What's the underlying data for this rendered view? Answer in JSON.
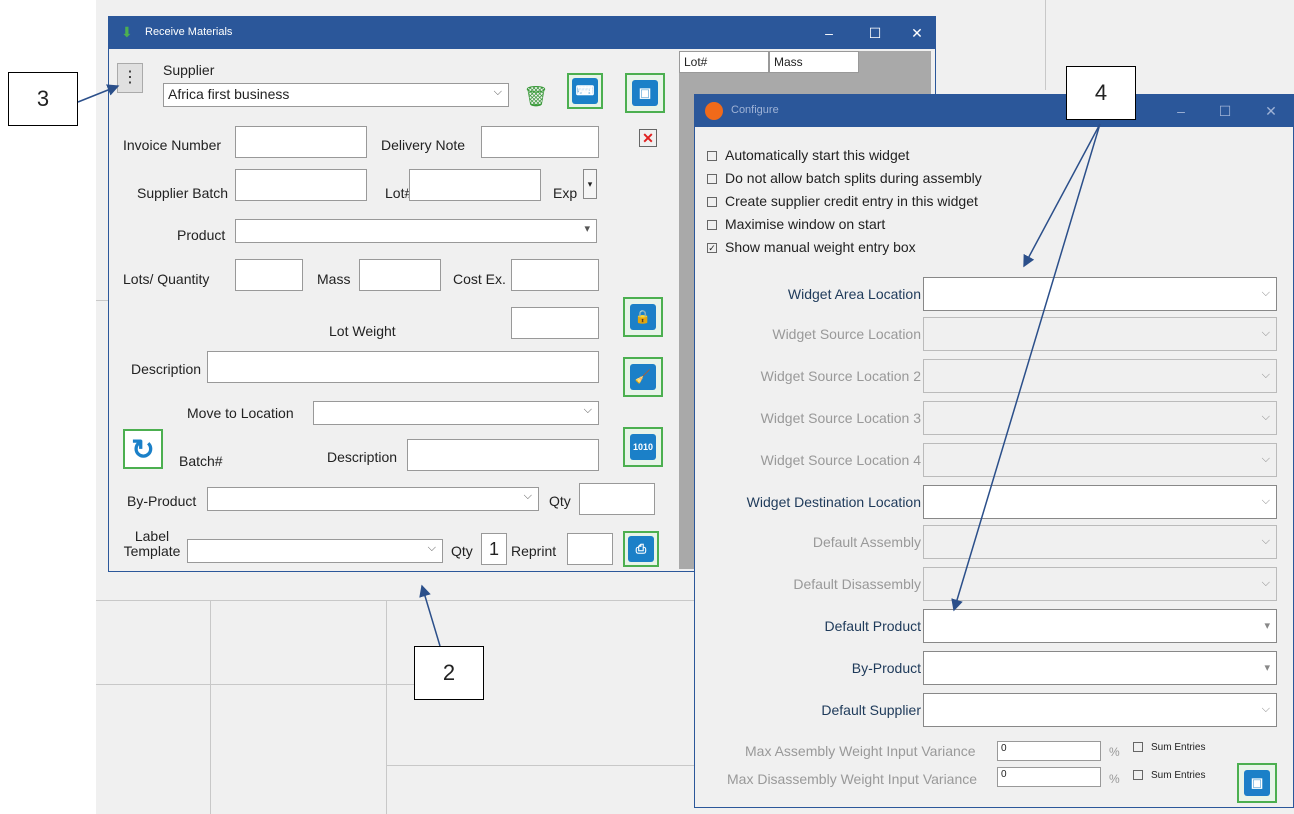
{
  "receive": {
    "title": "Receive Materials",
    "supplier_label": "Supplier",
    "supplier_value": "Africa first business",
    "invoice_label": "Invoice Number",
    "delivery_label": "Delivery Note",
    "supplier_batch_label": "Supplier Batch",
    "lot_label": "Lot#",
    "exp_label": "Exp",
    "product_label": "Product",
    "lots_qty_label": "Lots/ Quantity",
    "mass_label": "Mass",
    "cost_label": "Cost Ex.",
    "lot_weight_label": "Lot Weight",
    "description_label": "Description",
    "move_label": "Move to Location",
    "batch_label": "Batch#",
    "description2_label": "Description",
    "byproduct_label": "By-Product",
    "qty_label": "Qty",
    "label_template_label": "Label Template",
    "qty2_label": "Qty",
    "qty2_value": "1",
    "reprint_label": "Reprint",
    "menu_glyph": "⋮",
    "grid_headers": [
      "Lot#",
      "Mass"
    ]
  },
  "configure": {
    "title": "Configure",
    "checkboxes": [
      {
        "label": "Automatically start this widget",
        "checked": false
      },
      {
        "label": "Do not allow batch splits during assembly",
        "checked": false
      },
      {
        "label": "Create supplier credit entry in this widget",
        "checked": false
      },
      {
        "label": "Maximise window on start",
        "checked": false
      },
      {
        "label": "Show manual weight entry box",
        "checked": true
      }
    ],
    "fields": [
      {
        "label": "Widget Area Location",
        "enabled": true
      },
      {
        "label": "Widget Source Location",
        "enabled": false
      },
      {
        "label": "Widget Source Location 2",
        "enabled": false
      },
      {
        "label": "Widget Source Location 3",
        "enabled": false
      },
      {
        "label": "Widget Source Location 4",
        "enabled": false
      },
      {
        "label": "Widget Destination Location",
        "enabled": true
      },
      {
        "label": "Default Assembly",
        "enabled": false
      },
      {
        "label": "Default Disassembly",
        "enabled": false
      },
      {
        "label": "Default Product",
        "enabled": true
      },
      {
        "label": "By-Product",
        "enabled": true
      },
      {
        "label": "Default Supplier",
        "enabled": true
      }
    ],
    "max_assembly_label": "Max Assembly Weight Input Variance",
    "max_assembly_value": "0",
    "max_disassembly_label": "Max Disassembly Weight Input Variance",
    "max_disassembly_value": "0",
    "percent": "%",
    "sum_entries": "Sum Entries"
  },
  "callouts": {
    "c2": "2",
    "c3": "3",
    "c4": "4"
  },
  "colors": {
    "titlebar": "#2b579a",
    "accent_green": "#4caf50",
    "icon_blue": "#1b80c8",
    "delete_red": "#e02020"
  }
}
